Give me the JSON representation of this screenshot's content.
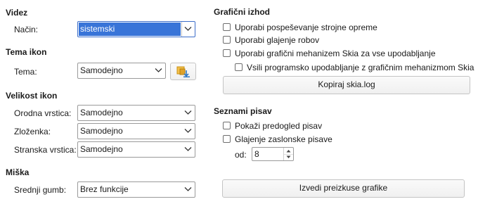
{
  "left": {
    "video": {
      "heading": "Videz",
      "mode_label": "Način:",
      "mode_value": "sistemski"
    },
    "icon_theme": {
      "heading": "Tema ikon",
      "theme_label": "Tema:",
      "theme_value": "Samodejno",
      "extension_icon": "add-icon-theme-extension-icon"
    },
    "icon_size": {
      "heading": "Velikost ikon",
      "toolbar_label": "Orodna vrstica:",
      "toolbar_value": "Samodejno",
      "notebookbar_label": "Zloženka:",
      "notebookbar_value": "Samodejno",
      "sidebar_label": "Stranska vrstica:",
      "sidebar_value": "Samodejno"
    },
    "mouse": {
      "heading": "Miška",
      "middle_label": "Srednji gumb:",
      "middle_value": "Brez funkcije"
    }
  },
  "right": {
    "graphics": {
      "heading": "Grafični izhod",
      "hw_accel": "Uporabi pospeševanje strojne opreme",
      "antialias": "Uporabi glajenje robov",
      "skia": "Uporabi grafični mehanizem Skia za vse upodabljanje",
      "force_skia_sw": "Vsili programsko upodabljanje z grafičnim mehanizmom Skia",
      "copy_log_button": "Kopiraj skia.log"
    },
    "fonts": {
      "heading": "Seznami pisav",
      "preview": "Pokaži predogled pisav",
      "screen_aa": "Glajenje zaslonske pisave",
      "from_label": "od:",
      "from_value": "8"
    },
    "run_tests_button": "Izvedi preizkuse grafike"
  },
  "colors": {
    "selection": "#3874d8",
    "border": "#9a9a9a"
  }
}
